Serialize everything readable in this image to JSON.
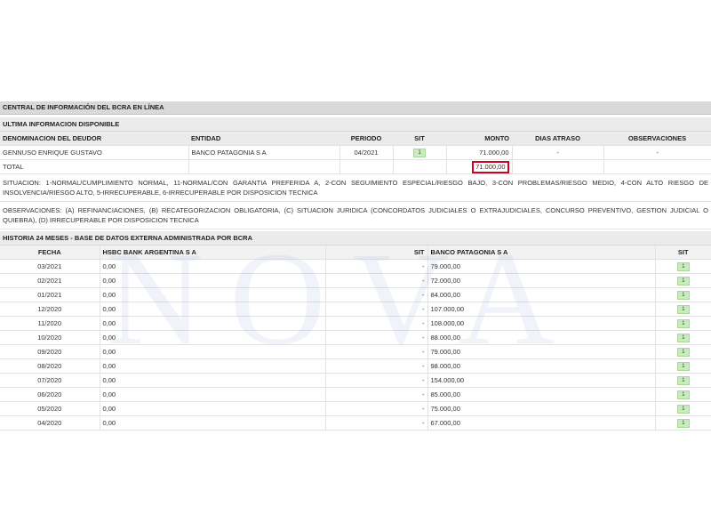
{
  "section_title": "CENTRAL DE INFORMACIÓN DEL BCRA EN LÍNEA",
  "ultima": {
    "title": "ULTIMA INFORMACION DISPONIBLE",
    "headers": {
      "deudor": "DENOMINACION DEL DEUDOR",
      "entidad": "ENTIDAD",
      "periodo": "PERIODO",
      "sit": "SIT",
      "monto": "MONTO",
      "dias": "DIAS ATRASO",
      "obs": "OBSERVACIONES"
    },
    "row": {
      "deudor": "GENNUSO ENRIQUE GUSTAVO",
      "entidad": "BANCO PATAGONIA S A",
      "periodo": "04/2021",
      "sit": "1",
      "monto": "71.000,00",
      "dias": "-",
      "obs": "-"
    },
    "total_label": "TOTAL",
    "total_value": "71.000,00"
  },
  "situacion_note": "SITUACION: 1-NORMAL/CUMPLIMIENTO NORMAL, 11-NORMAL/CON GARANTIA PREFERIDA A, 2-CON SEGUIMIENTO ESPECIAL/RIESGO BAJO, 3-CON PROBLEMAS/RIESGO MEDIO, 4-CON ALTO RIESGO DE INSOLVENCIA/RIESGO ALTO, 5-IRRECUPERABLE, 6-IRRECUPERABLE POR DISPOSICION TECNICA",
  "observaciones_note": "OBSERVACIONES: (A) REFINANCIACIONES, (B) RECATEGORIZACION OBLIGATORIA, (C) SITUACION JURIDICA (CONCORDATOS JUDICIALES O EXTRAJUDICIALES, CONCURSO PREVENTIVO, GESTION JUDICIAL O QUIEBRA), (D) IRRECUPERABLE POR DISPOSICION TECNICA",
  "historia": {
    "title": "HISTORIA 24 MESES - BASE DE DATOS EXTERNA ADMINISTRADA POR BCRA",
    "headers": {
      "fecha": "FECHA",
      "bank1": "HSBC BANK ARGENTINA S A",
      "sit1": "SIT",
      "bank2": "BANCO PATAGONIA S A",
      "sit2": "SIT"
    },
    "rows": [
      {
        "fecha": "03/2021",
        "v1": "0,00",
        "s1": "-",
        "v2": "79.000,00",
        "s2": "1"
      },
      {
        "fecha": "02/2021",
        "v1": "0,00",
        "s1": "-",
        "v2": "72.000,00",
        "s2": "1"
      },
      {
        "fecha": "01/2021",
        "v1": "0,00",
        "s1": "-",
        "v2": "84.000,00",
        "s2": "1"
      },
      {
        "fecha": "12/2020",
        "v1": "0,00",
        "s1": "-",
        "v2": "107.000,00",
        "s2": "1"
      },
      {
        "fecha": "11/2020",
        "v1": "0,00",
        "s1": "-",
        "v2": "108.000,00",
        "s2": "1"
      },
      {
        "fecha": "10/2020",
        "v1": "0,00",
        "s1": "-",
        "v2": "88.000,00",
        "s2": "1"
      },
      {
        "fecha": "09/2020",
        "v1": "0,00",
        "s1": "-",
        "v2": "79.000,00",
        "s2": "1"
      },
      {
        "fecha": "08/2020",
        "v1": "0,00",
        "s1": "-",
        "v2": "98.000,00",
        "s2": "1"
      },
      {
        "fecha": "07/2020",
        "v1": "0,00",
        "s1": "-",
        "v2": "154.000,00",
        "s2": "1"
      },
      {
        "fecha": "06/2020",
        "v1": "0,00",
        "s1": "-",
        "v2": "85.000,00",
        "s2": "1"
      },
      {
        "fecha": "05/2020",
        "v1": "0,00",
        "s1": "-",
        "v2": "75.000,00",
        "s2": "1"
      },
      {
        "fecha": "04/2020",
        "v1": "0,00",
        "s1": "-",
        "v2": "67.000,00",
        "s2": "1"
      }
    ]
  },
  "watermark": "NOVA"
}
